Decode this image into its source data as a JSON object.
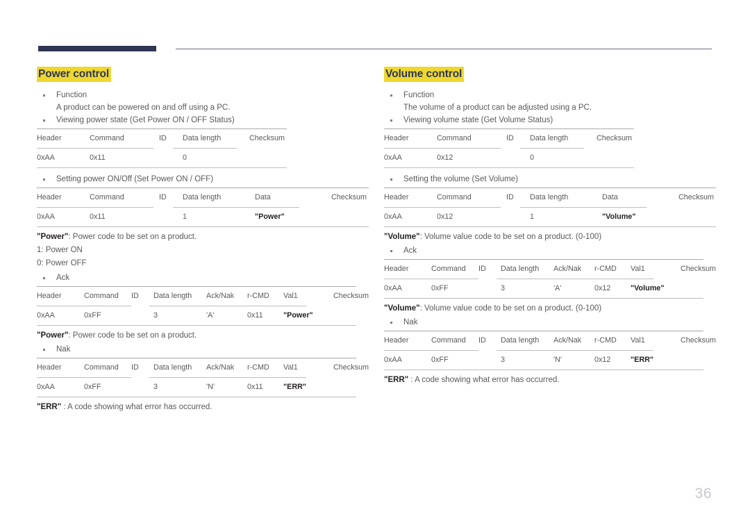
{
  "page": {
    "number": "36"
  },
  "left": {
    "heading": "Power control",
    "function_label": "Function",
    "function_desc": "A product can be powered on and off using a PC.",
    "get_status_label": "Viewing power state (Get Power ON / OFF Status)",
    "get_status_table": {
      "headers": [
        "Header",
        "Command",
        "ID",
        "Data length",
        "Checksum"
      ],
      "row": [
        "0xAA",
        "0x11",
        "",
        "0",
        ""
      ]
    },
    "set_label": "Setting power ON/Off (Set Power ON / OFF)",
    "set_table": {
      "headers": [
        "Header",
        "Command",
        "ID",
        "Data length",
        "Data",
        "Checksum"
      ],
      "row": [
        "0xAA",
        "0x11",
        "",
        "1",
        "\"Power\"",
        ""
      ]
    },
    "power_note_prefix": "\"Power\"",
    "power_note_rest": ": Power code to be set on a product.",
    "power_on": "1: Power ON",
    "power_off": "0: Power OFF",
    "ack_label": "Ack",
    "ack_table": {
      "headers": [
        "Header",
        "Command",
        "ID",
        "Data length",
        "Ack/Nak",
        "r-CMD",
        "Val1",
        "Checksum"
      ],
      "row": [
        "0xAA",
        "0xFF",
        "",
        "3",
        "'A'",
        "0x11",
        "\"Power\"",
        ""
      ]
    },
    "power_note2_prefix": "\"Power\"",
    "power_note2_rest": ": Power code to be set on a product.",
    "nak_label": "Nak",
    "nak_table": {
      "headers": [
        "Header",
        "Command",
        "ID",
        "Data length",
        "Ack/Nak",
        "r-CMD",
        "Val1",
        "Checksum"
      ],
      "row": [
        "0xAA",
        "0xFF",
        "",
        "3",
        "'N'",
        "0x11",
        "\"ERR\"",
        ""
      ]
    },
    "err_note_prefix": "\"ERR\"",
    "err_note_rest": " : A code showing what error has occurred."
  },
  "right": {
    "heading": "Volume control",
    "function_label": "Function",
    "function_desc": "The volume of a product can be adjusted using a PC.",
    "get_status_label": "Viewing volume state (Get Volume Status)",
    "get_status_table": {
      "headers": [
        "Header",
        "Command",
        "ID",
        "Data length",
        "Checksum"
      ],
      "row": [
        "0xAA",
        "0x12",
        "",
        "0",
        ""
      ]
    },
    "set_label": "Setting the volume (Set Volume)",
    "set_table": {
      "headers": [
        "Header",
        "Command",
        "ID",
        "Data length",
        "Data",
        "Checksum"
      ],
      "row": [
        "0xAA",
        "0x12",
        "",
        "1",
        "\"Volume\"",
        ""
      ]
    },
    "volume_note_prefix": "\"Volume\"",
    "volume_note_rest": ": Volume value code to be set on a product. (0-100)",
    "ack_label": "Ack",
    "ack_table": {
      "headers": [
        "Header",
        "Command",
        "ID",
        "Data length",
        "Ack/Nak",
        "r-CMD",
        "Val1",
        "Checksum"
      ],
      "row": [
        "0xAA",
        "0xFF",
        "",
        "3",
        "'A'",
        "0x12",
        "\"Volume\"",
        ""
      ]
    },
    "volume_note2_prefix": "\"Volume\"",
    "volume_note2_rest": ": Volume value code to be set on a product. (0-100)",
    "nak_label": "Nak",
    "nak_table": {
      "headers": [
        "Header",
        "Command",
        "ID",
        "Data length",
        "Ack/Nak",
        "r-CMD",
        "Val1",
        "Checksum"
      ],
      "row": [
        "0xAA",
        "0xFF",
        "",
        "3",
        "'N'",
        "0x12",
        "\"ERR\"",
        ""
      ]
    },
    "err_note_prefix": "\"ERR\"",
    "err_note_rest": " : A code showing what error has occurred."
  },
  "colors": {
    "navy": "#2e3653",
    "highlight": "#eed830",
    "body_text": "#58595b",
    "rule": "#a7a9ac"
  }
}
